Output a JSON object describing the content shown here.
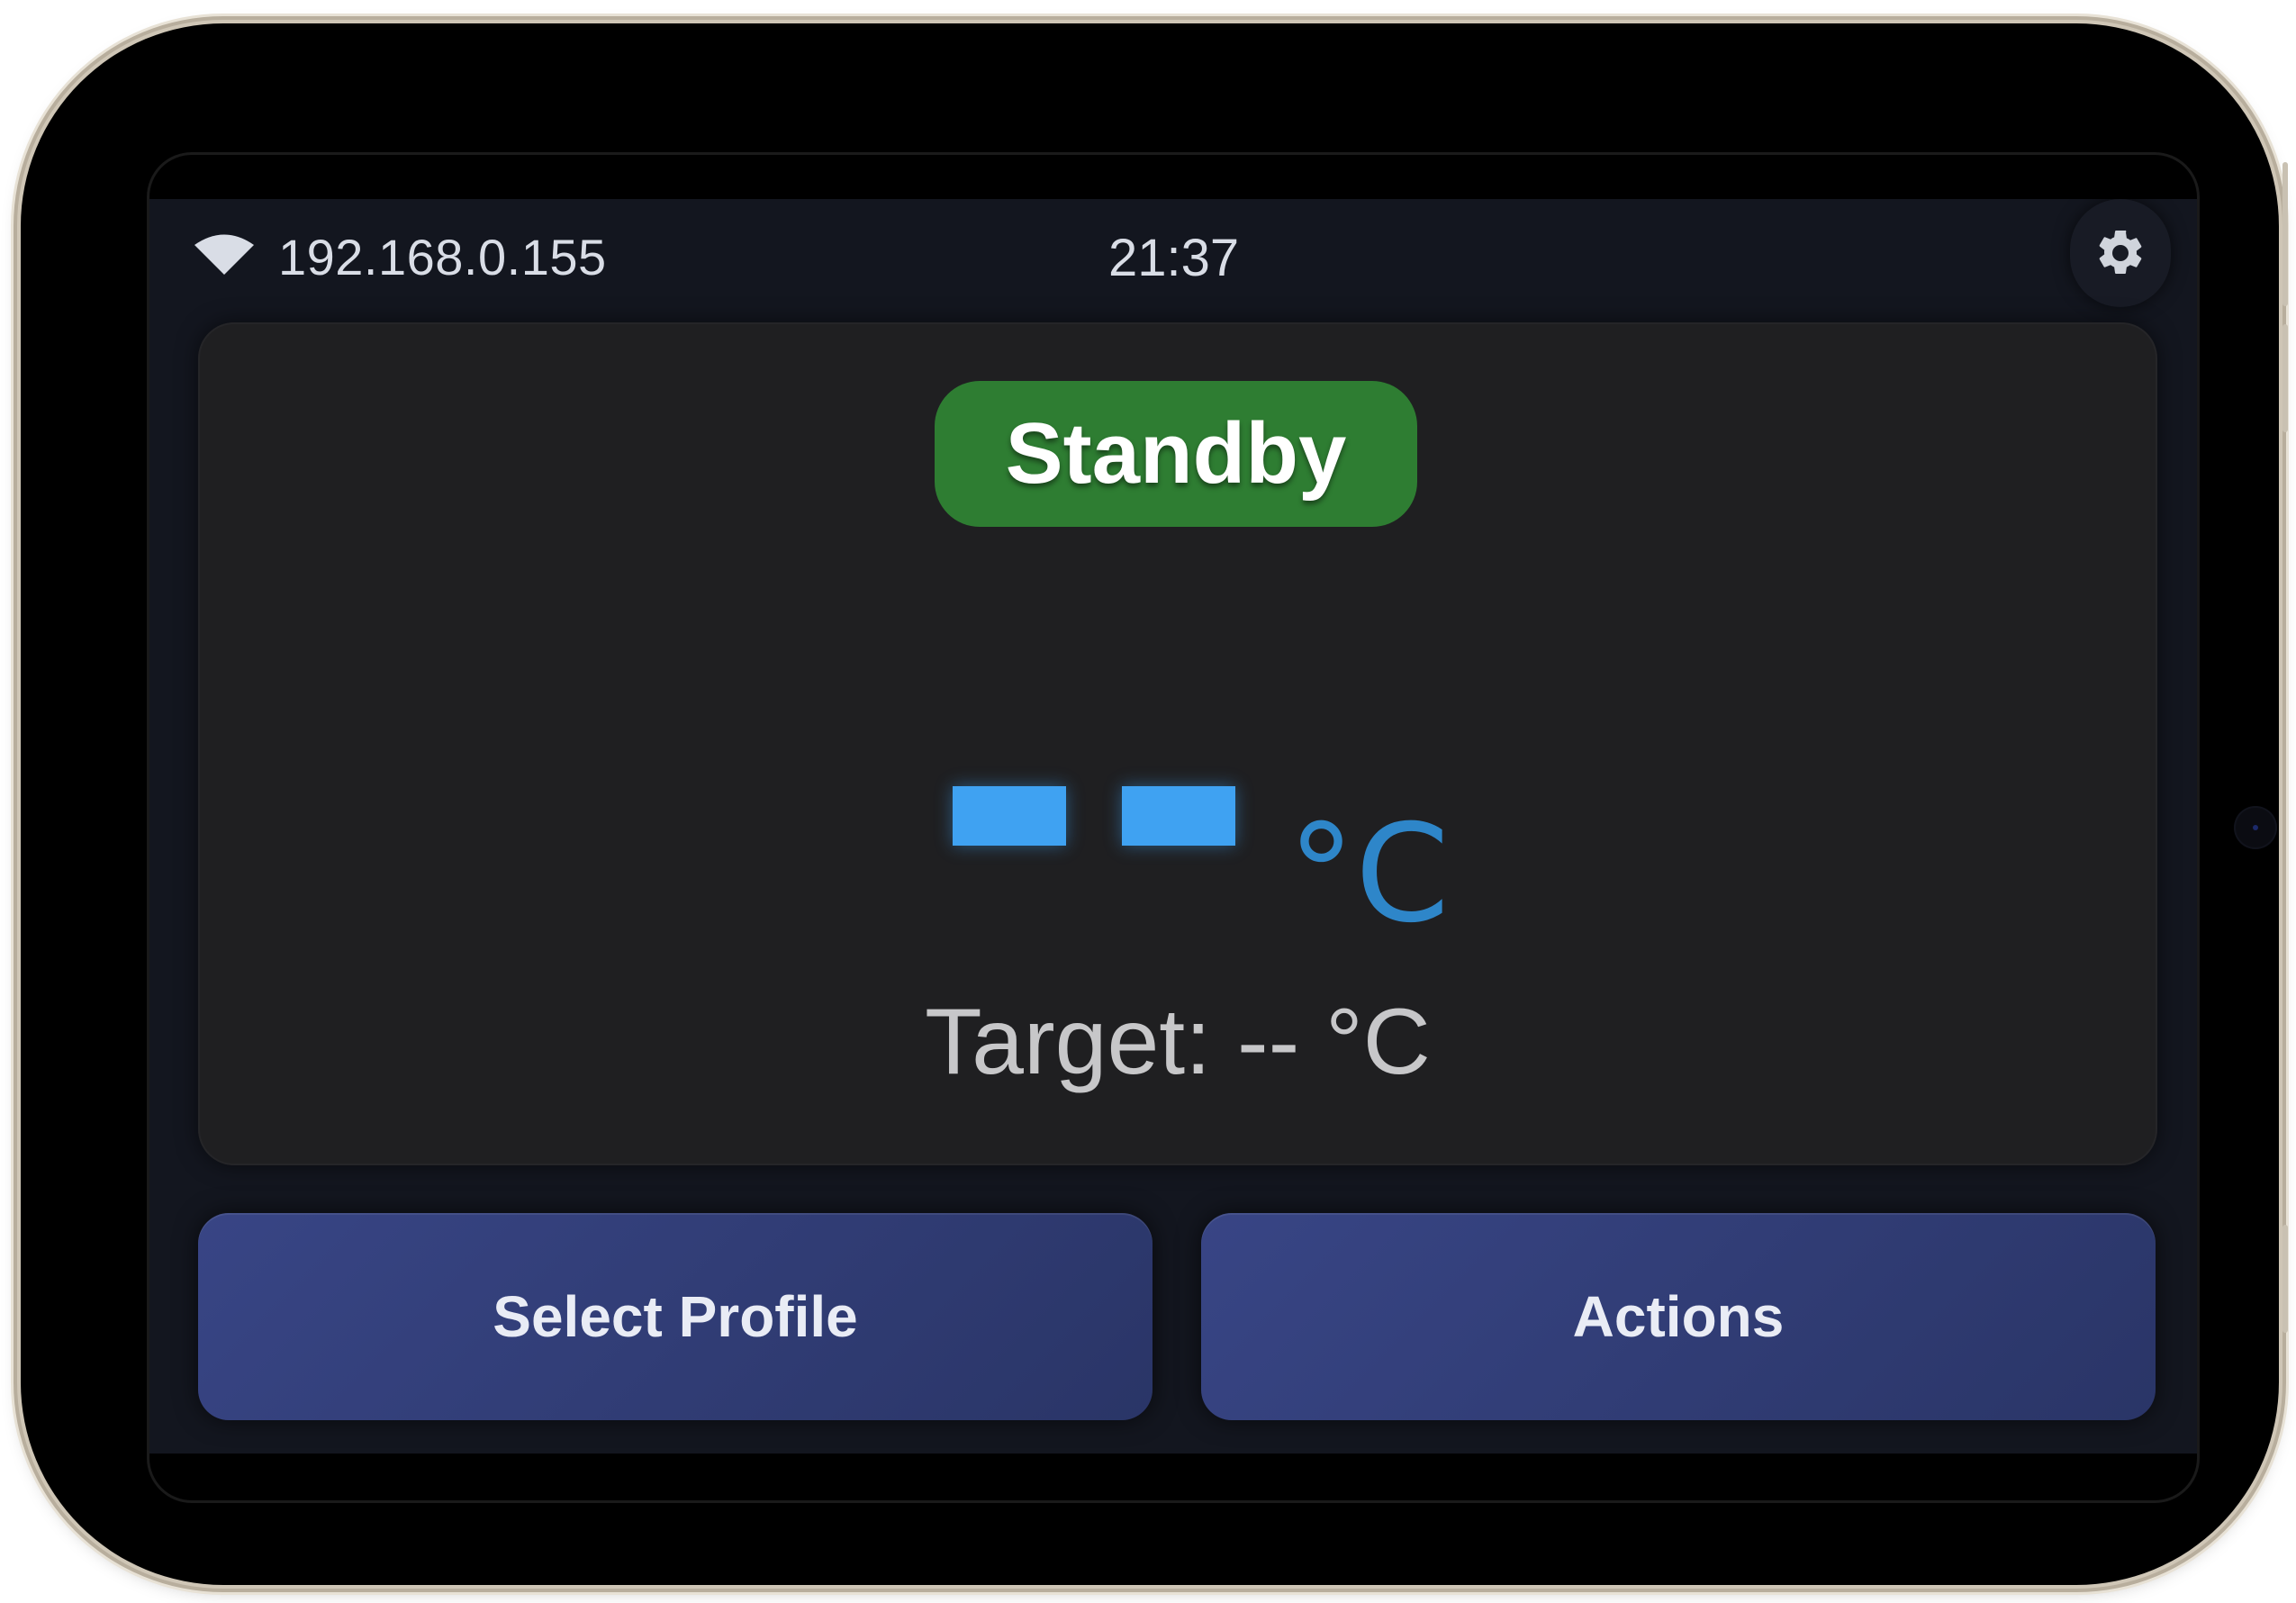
{
  "status_bar": {
    "wifi_icon": "wifi-icon",
    "ip_address": "192.168.0.155",
    "time": "21:37",
    "settings_icon": "gear-icon"
  },
  "main_card": {
    "status": "Standby",
    "status_color": "#2e7d32",
    "temperature_value": "--",
    "temperature_unit": "°C",
    "target_text": "Target: -- °C"
  },
  "buttons": {
    "select_profile": "Select Profile",
    "actions": "Actions"
  },
  "colors": {
    "accent_blue": "#3fa2f2",
    "button_bg": "#343f7c",
    "background": "#13161f"
  }
}
